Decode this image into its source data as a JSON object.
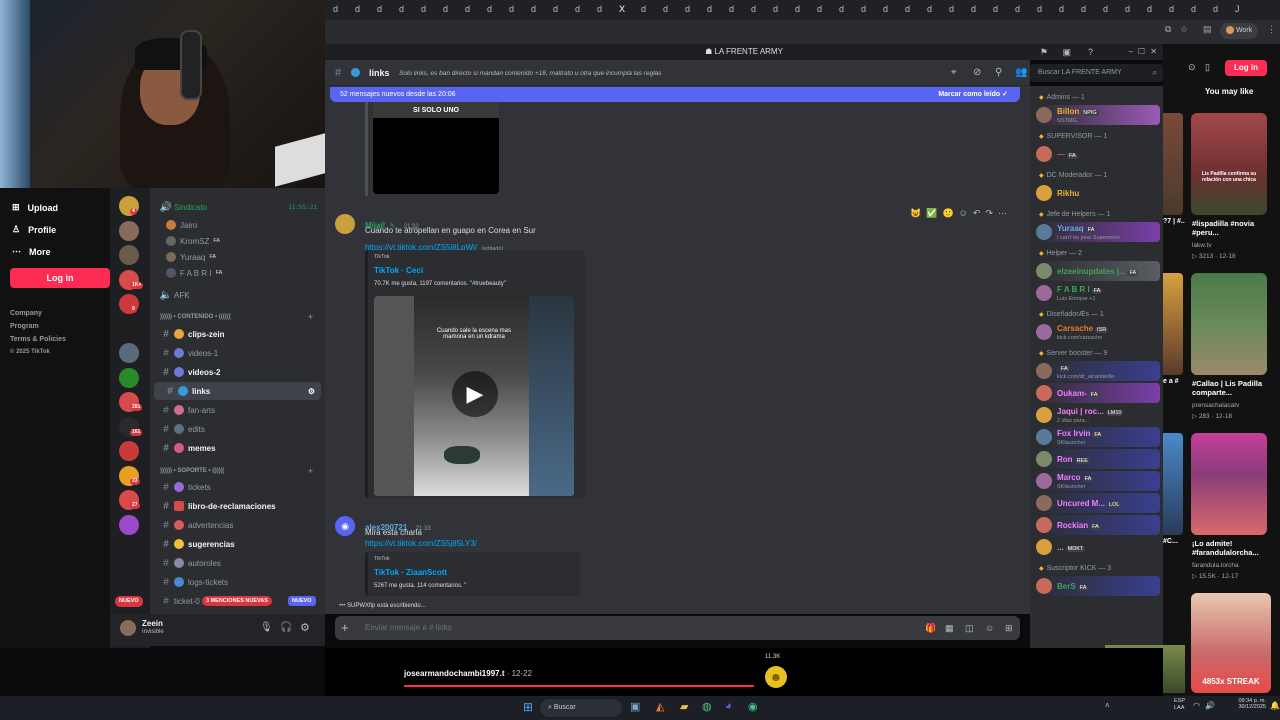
{
  "browser": {
    "tabs_glyphs": [
      "d",
      "d",
      "d",
      "d",
      "d",
      "d",
      "d",
      "d",
      "d",
      "d",
      "d",
      "d",
      "d",
      "X",
      "d",
      "d",
      "d",
      "d",
      "d",
      "d",
      "d",
      "d",
      "d",
      "d",
      "d",
      "d",
      "d",
      "d",
      "d",
      "d",
      "d",
      "d",
      "d",
      "d",
      "d",
      "d",
      "d",
      "d",
      "d",
      "d",
      "d",
      "J"
    ],
    "profile_label": "Work"
  },
  "tiktok_left": {
    "nav": [
      {
        "label": "Upload",
        "icon": "plus-square-icon"
      },
      {
        "label": "Profile",
        "icon": "person-icon"
      },
      {
        "label": "More",
        "icon": "more-dots-icon"
      }
    ],
    "login_label": "Log in",
    "footer": [
      "Company",
      "Program",
      "Terms & Policies",
      "© 2025 TikTok"
    ]
  },
  "discord": {
    "server_name": "LA FRENTE ARMY",
    "channel_name": "links",
    "channel_topic": "Solo links, es ban directo si mandan contenido +18, maltrato u otra que incumpla las reglas",
    "search_placeholder": "Buscar LA FRENTE ARMY",
    "new_messages_banner": "52 mensajes nuevos desde las 20:06",
    "mark_read_label": "Marcar como leído",
    "guild_badges": [
      "4",
      "",
      "",
      "1K+",
      "9",
      "",
      "",
      "",
      "281",
      "161",
      "",
      "33",
      "27",
      "",
      "NUEVO"
    ],
    "channels": [
      {
        "name": "Sindicato",
        "kind": "voice",
        "bold": false,
        "time": "11:55:21"
      },
      {
        "name": "Jairo",
        "kind": "user",
        "bold": false
      },
      {
        "name": "KromSZ",
        "kind": "user",
        "bold": false,
        "badge": "FA"
      },
      {
        "name": "Yuraaq",
        "kind": "user",
        "bold": false,
        "badge": "FA"
      },
      {
        "name": "F A B R I",
        "kind": "user",
        "bold": false,
        "badge": "FA"
      },
      {
        "name": "AFK",
        "kind": "voice",
        "bold": false
      }
    ],
    "category_contenido": ")))))) • CONTENIDO • ((((((",
    "text_channels": [
      {
        "name": "clips-zein",
        "bold": true
      },
      {
        "name": "videos-1",
        "bold": false
      },
      {
        "name": "videos-2",
        "bold": true
      },
      {
        "name": "links",
        "bold": true,
        "selected": true
      },
      {
        "name": "fan-arts",
        "bold": false
      },
      {
        "name": "edits",
        "bold": false
      },
      {
        "name": "memes",
        "bold": true
      }
    ],
    "category_soporte": ")))))) • SOPORTE • ((((((",
    "support_channels": [
      {
        "name": "tickets",
        "bold": false
      },
      {
        "name": "libro-de-reclamaciones",
        "bold": true
      },
      {
        "name": "advertencias",
        "bold": false
      },
      {
        "name": "sugerencias",
        "bold": true
      },
      {
        "name": "autoroles",
        "bold": false
      },
      {
        "name": "logs-tickets",
        "bold": false
      },
      {
        "name": "ticket-0",
        "bold": false
      }
    ],
    "mentions_badge": "3 MENCIONES NUEVAS",
    "new_badge": "NUEVO",
    "user": {
      "name": "Zeein",
      "status": "Invisible"
    },
    "messages": [
      {
        "author": "Mijail",
        "time": "21:32",
        "text": "Cuando te atropellan en guapo en Corea en Sur",
        "link": "https://vt.tiktok.com/ZS5j8LpWj/",
        "edited": "(editado)",
        "embed_provider": "TikTok",
        "embed_title": "TikTok · Ceci",
        "embed_desc": "70.7K me gusta, 1197 comentarios. \"#truebeauty\"",
        "video_caption": "Cuando sale la escena mas mamona en un kdrama"
      },
      {
        "author": "alex200721",
        "time": "21:33",
        "text": "Mira esta charla",
        "link": "https://vt.tiktok.com/ZS5j85LY3/",
        "embed_provider": "TikTok",
        "embed_title": "TikTok · ZiaanScott",
        "embed_desc": "5267 me gusta, 114 comentarios. \"",
        "video_caption": ""
      }
    ],
    "prev_video_caption": "SI SOLO UNO",
    "typing": "SUPWXfip está escribiendo...",
    "composer_placeholder": "Enviar mensaje a # links",
    "member_groups": [
      {
        "title": "Admins — 1",
        "members": [
          {
            "name": "Billon",
            "sub": "NSTMG",
            "color": "#f0b232",
            "badge": "NPIG",
            "hl": "#9b59b6"
          }
        ]
      },
      {
        "title": "SUPERVISOR — 1",
        "members": [
          {
            "name": "—",
            "sub": "",
            "color": "#e74c3c",
            "badge": "FA",
            "hl": ""
          }
        ]
      },
      {
        "title": "DC Moderador — 1",
        "members": [
          {
            "name": "Rikhu",
            "sub": "",
            "color": "#f0b232",
            "badge": "",
            "hl": ""
          }
        ]
      },
      {
        "title": "Jefe de Helpers — 1",
        "members": [
          {
            "name": "Yuraaq",
            "sub": "I can't be your Supermom",
            "color": "#5dade2",
            "badge": "FA",
            "hl": "#7b3fa8"
          }
        ]
      },
      {
        "title": "Helper — 2",
        "members": [
          {
            "name": "elzeeinupdates |...",
            "sub": "",
            "color": "#3ba55d",
            "badge": "FA",
            "hl": "#5a5d63"
          },
          {
            "name": "F A B R I",
            "sub": "Luis Enrique +1",
            "color": "#3ba55d",
            "badge": "FA",
            "hl": ""
          }
        ]
      },
      {
        "title": "DiseñadorÆs — 1",
        "members": [
          {
            "name": "Carsache",
            "sub": "kick.com/carsache",
            "color": "#e67e22",
            "badge": "ISR",
            "hl": ""
          }
        ]
      },
      {
        "title": "Server booster — 9",
        "members": [
          {
            "name": "",
            "sub": "kick.com/dr_alcantarille",
            "color": "#f47fff",
            "badge": "FA",
            "hl": "#3a3f8f"
          },
          {
            "name": "Oukam-",
            "sub": "",
            "color": "#f47fff",
            "badge": "FA",
            "hl": "#7b3fa8"
          },
          {
            "name": "Jaqui | roc...",
            "sub": "2 días para...",
            "color": "#f47fff",
            "badge": "LM10",
            "hl": ""
          },
          {
            "name": "Fox Irvin",
            "sub": "SKlauncher",
            "color": "#f47fff",
            "badge": "FA",
            "hl": "#3a3f8f"
          },
          {
            "name": "Ron",
            "sub": "",
            "color": "#f47fff",
            "badge": "REE",
            "hl": "#3a3f8f"
          },
          {
            "name": "Marco",
            "sub": "SKlauncher",
            "color": "#f47fff",
            "badge": "FA",
            "hl": "#3a3f8f"
          },
          {
            "name": "Uncured M...",
            "sub": "",
            "color": "#f47fff",
            "badge": "LOL",
            "hl": "#3a3f8f"
          },
          {
            "name": "Rockian",
            "sub": "",
            "color": "#f47fff",
            "badge": "FA",
            "hl": "#3a3f8f"
          },
          {
            "name": "...",
            "sub": "",
            "color": "#f47fff",
            "badge": "MDKT",
            "hl": ""
          }
        ]
      },
      {
        "title": "Suscriptor KICK — 3",
        "members": [
          {
            "name": "BerS",
            "sub": "",
            "color": "#3ba55d",
            "badge": "FA",
            "hl": "#3a3f8f"
          }
        ]
      }
    ]
  },
  "tiktok_right": {
    "login_label": "Log in",
    "heading": "You may like",
    "cards": [
      {
        "title": "#lispadilla #novia #peru...",
        "author": "lakw.tv",
        "stats": "3213 · 12-18",
        "overlay": "Lis Padilla confirma su relación con una chica",
        "color": "#7a3b3b"
      },
      {
        "title": "#Callao | Lis Padilla comparte...",
        "author": "prensachalacatv",
        "stats": "283 · 12-18",
        "overlay": "",
        "color": "#3d5a3b"
      },
      {
        "title": "¡Lo admite! #farandulalorcha...",
        "author": "farandula.lorcha",
        "stats": "15.5K · 12-17",
        "overlay": "",
        "color": "#8a3c7a"
      },
      {
        "title": "",
        "author": "",
        "stats": "",
        "overlay": "4853x STREAK",
        "color": "#c94a4a"
      }
    ],
    "partial_labels": [
      "?7 | #...",
      "e a #",
      "#C..."
    ]
  },
  "live": {
    "username": "josearmandochambi1997.t",
    "time": "12-22",
    "viewers": "11.3K"
  },
  "taskbar": {
    "search_label": "Buscar",
    "lang": "ESP\nLAA",
    "clock": "09:34 p. m.",
    "date": "30/12/2025"
  }
}
